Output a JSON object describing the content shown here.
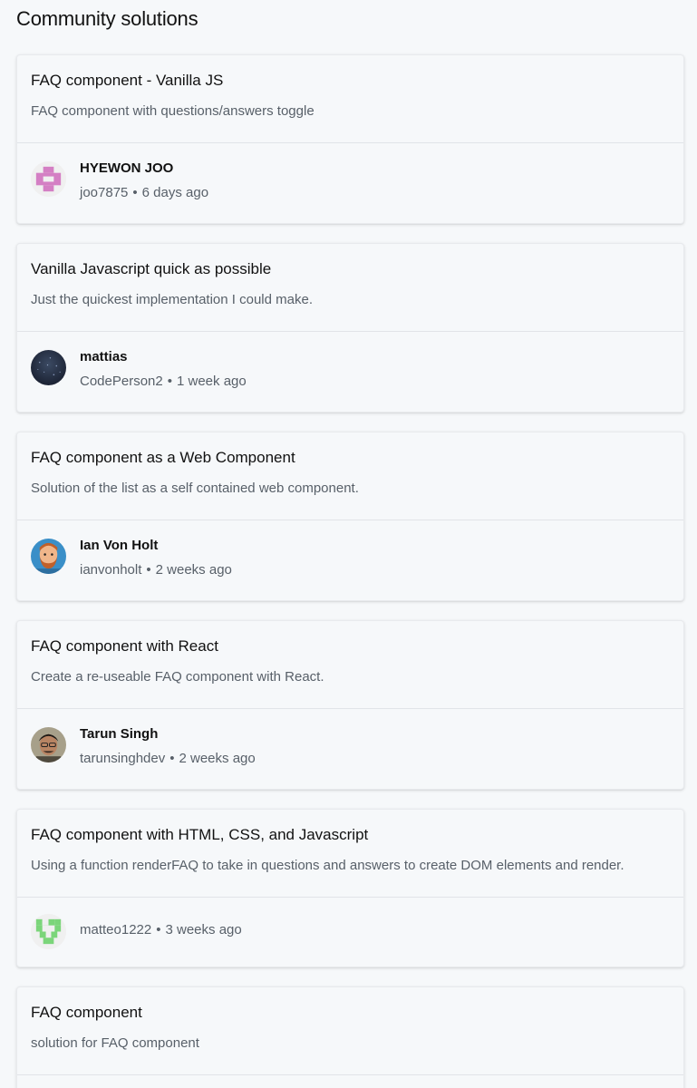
{
  "page": {
    "title": "Community solutions"
  },
  "solutions": [
    {
      "title": "FAQ component - Vanilla JS",
      "description": "FAQ component with questions/answers toggle",
      "author_name": "HYEWON JOO",
      "username": "joo7875",
      "time": "6 days ago",
      "avatar": "identicon-pink-cross"
    },
    {
      "title": "Vanilla Javascript quick as possible",
      "description": "Just the quickest implementation I could make.",
      "author_name": "mattias",
      "username": "CodePerson2",
      "time": "1 week ago",
      "avatar": "photo-dark-starfield"
    },
    {
      "title": "FAQ component as a Web Component",
      "description": "Solution of the list as a self contained web component.",
      "author_name": "Ian Von Holt",
      "username": "ianvonholt",
      "time": "2 weeks ago",
      "avatar": "illustrated-bearded-man"
    },
    {
      "title": "FAQ component with React",
      "description": "Create a re-useable FAQ component with React.",
      "author_name": "Tarun Singh",
      "username": "tarunsinghdev",
      "time": "2 weeks ago",
      "avatar": "photo-man-with-glasses"
    },
    {
      "title": "FAQ component with HTML, CSS, and Javascript",
      "description": "Using a function renderFAQ to take in questions and answers to create DOM elements and render.",
      "author_name": "",
      "username": "matteo1222",
      "time": "3 weeks ago",
      "avatar": "identicon-green"
    },
    {
      "title": "FAQ component",
      "description": "solution for FAQ component",
      "author_name": "",
      "username": "",
      "time": "",
      "avatar": ""
    }
  ]
}
